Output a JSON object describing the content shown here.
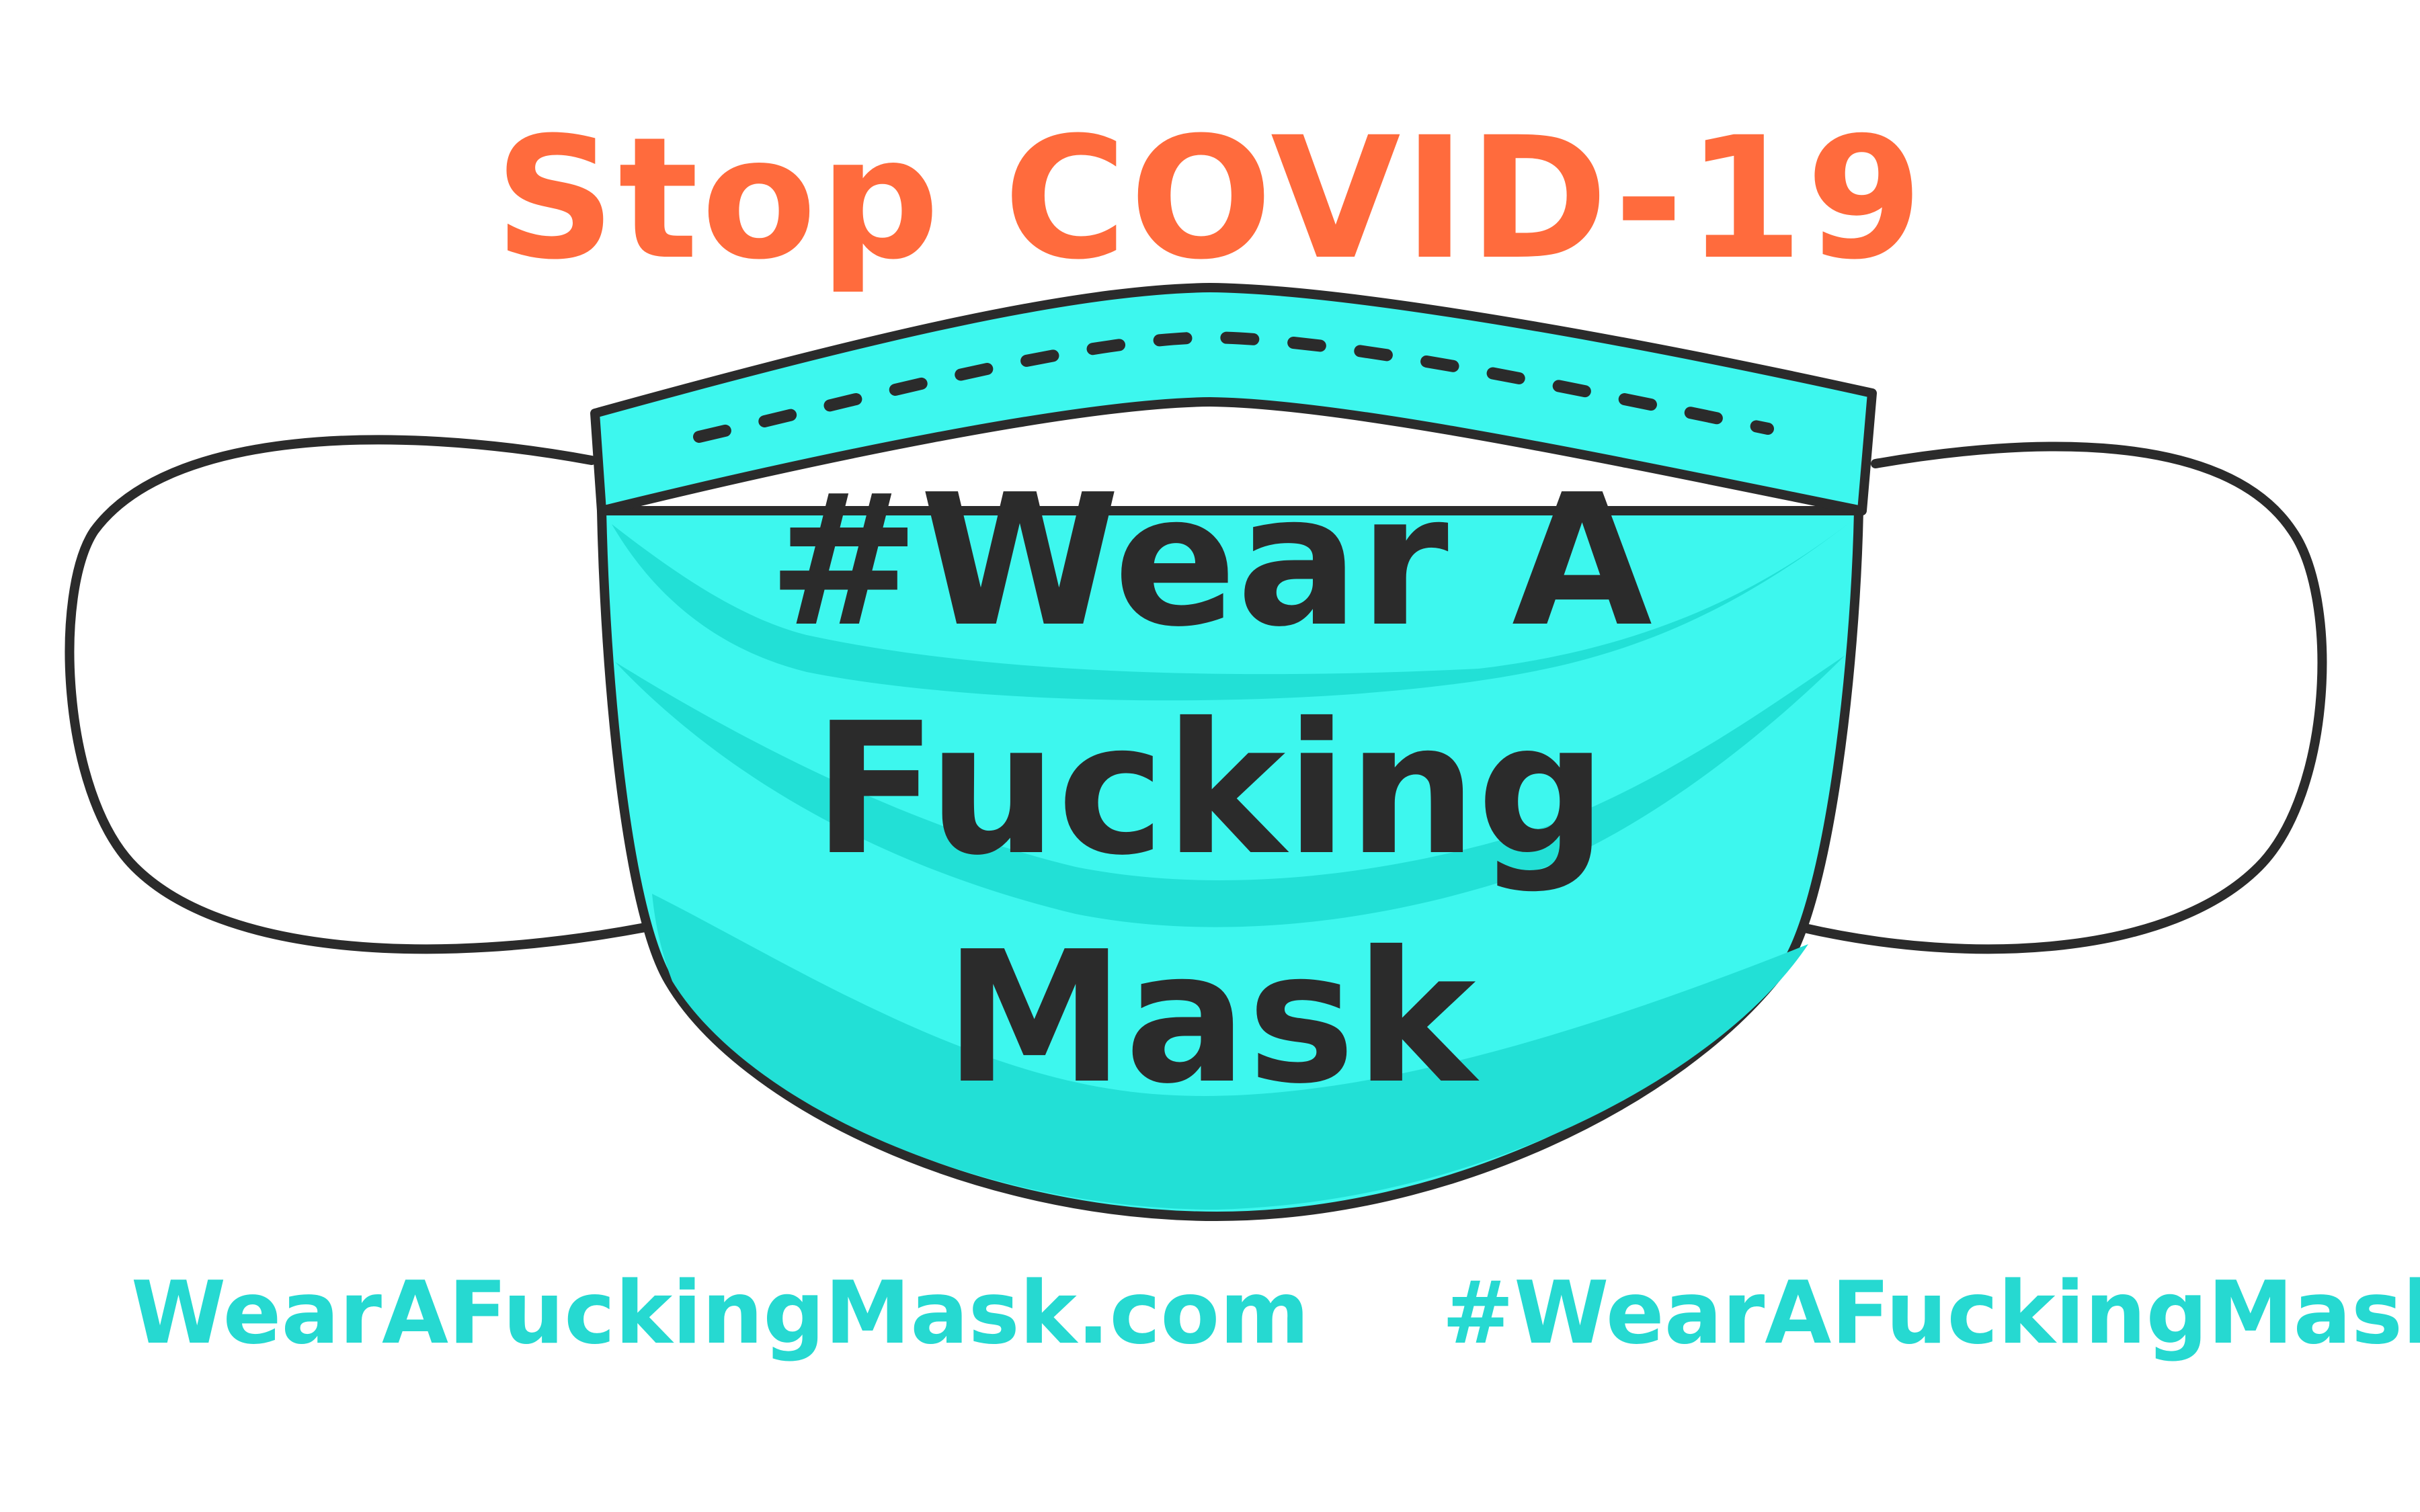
{
  "headline": {
    "text": "Stop COVID-19"
  },
  "mask_slogan": {
    "line1": "#Wear A",
    "line2": "Fucking",
    "line3": "Mask"
  },
  "footer": {
    "website": "WearAFuckingMask.com",
    "hashtag": "#WearAFuckingMask"
  },
  "colors": {
    "headline": "#FF6B3D",
    "accent": "#26D9D1",
    "mask_light": "#3DF7EE",
    "mask_shade": "#22E0D6",
    "outline": "#2B2B2B",
    "text_dark": "#2B2B2B"
  }
}
